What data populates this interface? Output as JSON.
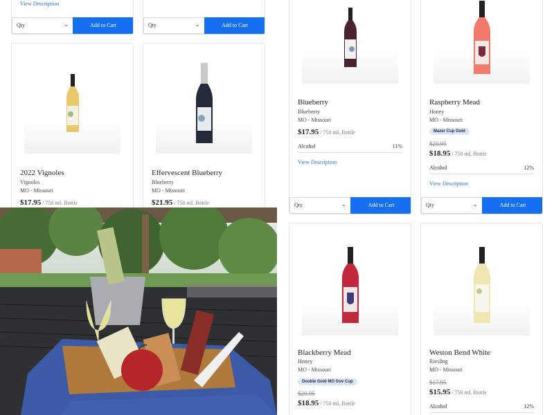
{
  "left_pane": {
    "top_cards": [
      {
        "view_label": "View Description",
        "qty_label": "Qty",
        "cart_label": "Add to Cart"
      },
      {
        "qty_label": "Qty",
        "cart_label": "Add to Cart"
      }
    ],
    "products": [
      {
        "name": "2022 Vignoles",
        "varietal": "Vignoles",
        "region": "MO - Missouri",
        "price": "$17.95",
        "unit": " / 750 mL Bottle"
      },
      {
        "name": "Effervescent Blueberry",
        "varietal": "Blueberry",
        "region": "MO - Missouri",
        "price": "$21.95",
        "unit": " / 750 mL Bottle"
      }
    ]
  },
  "right_pane": {
    "products": [
      {
        "name": "Blueberry",
        "varietal": "Blueberry",
        "region": "MO - Missouri",
        "price": "$17.95",
        "unit": " / 750 mL Bottle",
        "alcohol_label": "Alcohol",
        "alcohol_value": "11%",
        "view_label": "View Description",
        "qty_label": "Qty",
        "cart_label": "Add to Cart"
      },
      {
        "name": "Raspberry Mead",
        "varietal": "Honey",
        "region": "MO - Missouri",
        "badge": "Mazer Cup Gold",
        "old_price": "$20.95",
        "price": "$18.95",
        "unit": " / 750 mL Bottle",
        "alcohol_label": "Alcohol",
        "alcohol_value": "12%",
        "view_label": "View Description",
        "qty_label": "Qty",
        "cart_label": "Add to Cart"
      },
      {
        "name": "Blackberry Mead",
        "varietal": "Honey",
        "region": "MO - Missouri",
        "badge": "Double Gold MO Gov Cup",
        "old_price": "$20.95",
        "price": "$18.95",
        "unit": " / 750 mL Bottle"
      },
      {
        "name": "Weston Bend White",
        "varietal": "Riesling",
        "region": "MO - Missouri",
        "old_price": "$17.95",
        "price": "$15.95",
        "unit": " / 750 mL Bottle",
        "alcohol_label": "Alcohol",
        "alcohol_value": "12%"
      }
    ]
  },
  "colors": {
    "button": "#1570ef",
    "link": "#2e6fd6",
    "badge_bg": "#dbe5f5"
  },
  "icons": {
    "dropdown": "chevron-down-icon"
  }
}
